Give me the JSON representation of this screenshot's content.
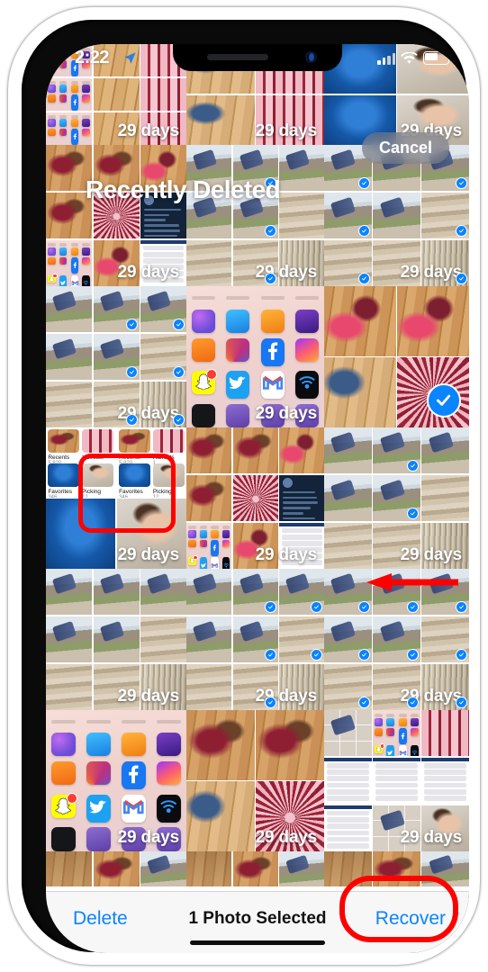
{
  "device": {
    "name": "iPhone",
    "frame": "notch"
  },
  "status_bar": {
    "time": "2:22",
    "location_icon": "location-arrow-icon",
    "signal_icon": "cellular-signal-icon",
    "wifi_icon": "wifi-icon",
    "battery_icon": "battery-icon"
  },
  "header": {
    "title": "Recently Deleted",
    "cancel_label": "Cancel"
  },
  "toolbar": {
    "delete_label": "Delete",
    "selection_label": "1 Photo Selected",
    "recover_label": "Recover"
  },
  "grid": {
    "expiry_label": "29 days",
    "columns": 3,
    "rows": 6,
    "selected_count": 1
  },
  "albums": [
    {
      "name": "Recents",
      "count": "5,820"
    },
    {
      "name": "Haircuts",
      "count": "1"
    },
    {
      "name": "Favorites",
      "count": "346"
    },
    {
      "name": "Picking",
      "count": "12"
    }
  ],
  "springboard_apps": {
    "row_labels_top": [
      "Utilities",
      "Tips",
      "Contacts",
      "Apple Store"
    ],
    "rows": [
      [
        "Clips",
        "Keynote",
        "Pages",
        "iMovie"
      ],
      [
        "iTunes U",
        "Instagram",
        "Facebook",
        "Messenger"
      ],
      [
        "Snapchat",
        "Twitter",
        "Gmail",
        "iSub"
      ]
    ],
    "dock": [
      "THINK DIRTY",
      "",
      ""
    ]
  },
  "annotations": {
    "recents_highlight": "red-rounded-rectangle",
    "pointer": "red-left-arrow",
    "recover_highlight": "red-ellipse",
    "color": "#FF0000"
  },
  "colors": {
    "accent_blue": "#0A84FF",
    "selection_blue": "#0A84FF",
    "toolbar_bg": "#F7F7F7",
    "annotation_red": "#FF0000"
  }
}
